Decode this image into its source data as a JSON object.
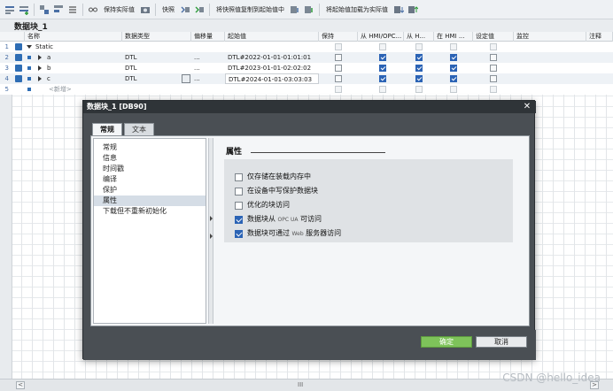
{
  "toolbar": {
    "keep_actual": "保持实际值",
    "snapshot": "快照",
    "copy_snapshot": "将快照值复制到起始值中",
    "load_start": "将起始值加载为实际值"
  },
  "block_title": "数据块_1",
  "columns": [
    "名称",
    "数据类型",
    "偏移量",
    "起始值",
    "保持",
    "从 HMI/OPC...",
    "从 H...",
    "在 HMI ...",
    "设定值",
    "监控",
    "注释"
  ],
  "rows": [
    {
      "num": "1",
      "name": "Static",
      "type": "",
      "offset": "",
      "start": ""
    },
    {
      "num": "2",
      "name": "a",
      "type": "DTL",
      "offset": "...",
      "start": "DTL#2022-01-01-01:01:01"
    },
    {
      "num": "3",
      "name": "b",
      "type": "DTL",
      "offset": "...",
      "start": "DTL#2023-01-01-02:02:02"
    },
    {
      "num": "4",
      "name": "c",
      "type": "DTL",
      "offset": "...",
      "start": "DTL#2024-01-01-03:03:03"
    },
    {
      "num": "5",
      "name": "<新增>",
      "type": "",
      "offset": "",
      "start": ""
    }
  ],
  "dialog": {
    "title": "数据块_1 [DB90]",
    "tabs": [
      "常规",
      "文本"
    ],
    "nav": [
      "常规",
      "信息",
      "时间戳",
      "编译",
      "保护",
      "属性",
      "下载但不重新初始化"
    ],
    "section": "属性",
    "options": [
      {
        "pre": "仅存储在装载内存中",
        "mid": "",
        "post": "",
        "checked": false
      },
      {
        "pre": "在设备中写保护数据块",
        "mid": "",
        "post": "",
        "checked": false
      },
      {
        "pre": "优化的块访问",
        "mid": "",
        "post": "",
        "checked": false
      },
      {
        "pre": "数据块从 ",
        "mid": "OPC UA",
        "post": " 可访问",
        "checked": true
      },
      {
        "pre": "数据块可通过 ",
        "mid": "Web",
        "post": " 服务器访问",
        "checked": true
      }
    ],
    "ok": "确定",
    "cancel": "取消"
  },
  "scroll": {
    "left": "<",
    "mid": "III",
    "right": ">"
  },
  "watermark": "CSDN @hello_idea"
}
